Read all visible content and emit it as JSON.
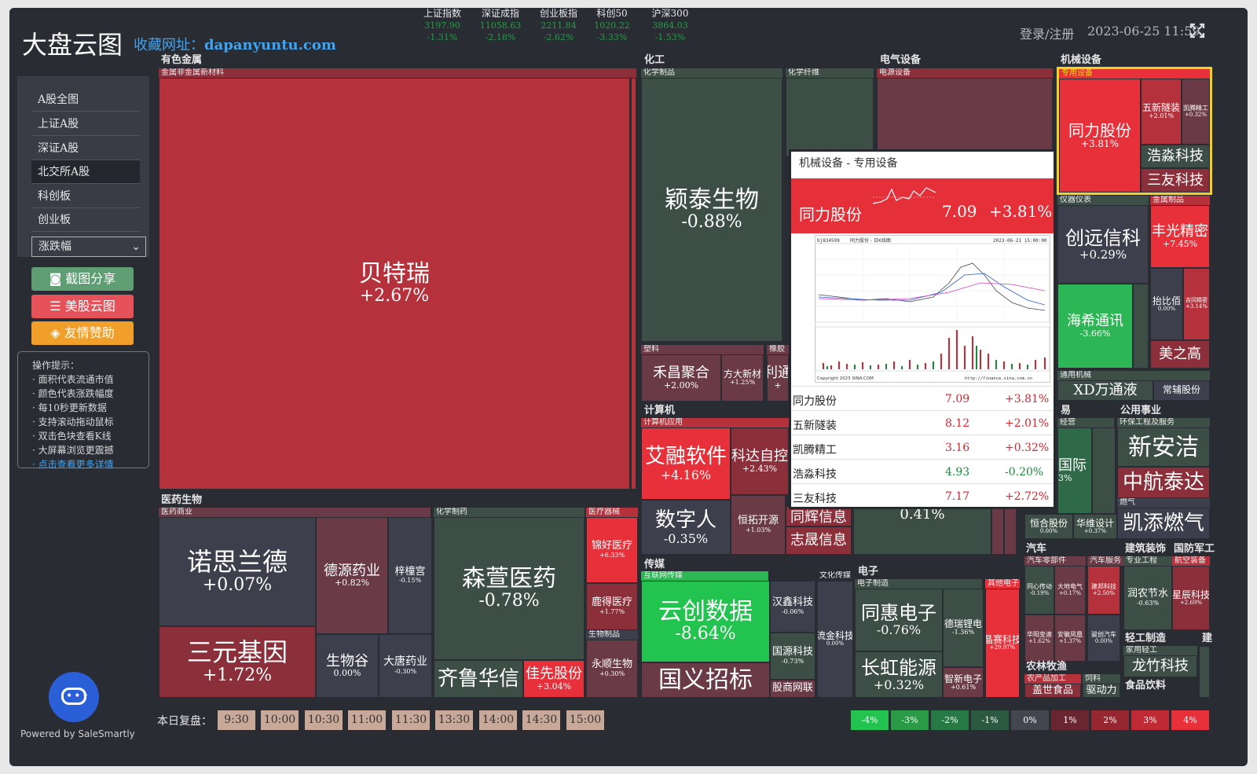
{
  "header": {
    "logo": "大盘云图",
    "fav_label": "收藏网址：",
    "fav_url": "dapanyuntu.com",
    "login": "登录/注册",
    "datetime": "2023-06-25 11:59",
    "indices": [
      {
        "name": "上证指数",
        "value": "3197.90",
        "change": "-1.31%"
      },
      {
        "name": "深证成指",
        "value": "11058.63",
        "change": "-2.18%"
      },
      {
        "name": "创业板指",
        "value": "2211.84",
        "change": "-2.62%"
      },
      {
        "name": "科创50",
        "value": "1020.22",
        "change": "-3.33%"
      },
      {
        "name": "沪深300",
        "value": "3864.03",
        "change": "-1.53%"
      }
    ]
  },
  "sidebar": {
    "items": [
      "A股全图",
      "上证A股",
      "深证A股",
      "北交所A股",
      "科创板",
      "创业板"
    ],
    "select": "涨跌幅",
    "btn_share": "截图分享",
    "btn_us": "美股云图",
    "btn_donate": "友情赞助",
    "tips_title": "操作提示：",
    "tips": [
      "· 面积代表流通市值",
      "· 颜色代表涨跌幅度",
      "· 每10秒更新数据",
      "· 支持滚动拖动鼠标",
      "· 双击色块查看K线",
      "· 大屏幕浏览更震撼"
    ],
    "tips_link": "· 点击查看更多详情",
    "powered": "Powered by SaleSmartly"
  },
  "sectors": {
    "s1": "有色金属",
    "s1a": "金属非金属新材料",
    "s2": "化工",
    "s2a": "化学制品",
    "s2b": "化学纤维",
    "s2c": "塑料",
    "s2d": "橡胶",
    "s3": "电气设备",
    "s3a": "电源设备",
    "s4": "机械设备",
    "s4a": "专用设备",
    "s4b": "仪器仪表",
    "s4c": "金属制品",
    "s4d": "通用机械",
    "s5": "医药生物",
    "s5a": "医药商业",
    "s5b": "化学制药",
    "s5c": "医疗器械",
    "s5d": "生物制品",
    "s6": "计算机",
    "s6a": "计算机应用",
    "s7": "传媒",
    "s7a": "互联网传媒",
    "s7b": "文化传媒",
    "s8": "电子",
    "s8a": "电子制造",
    "s8b": "其他电子",
    "s9": "公用事业",
    "s9a": "环保工程及服务",
    "s9b": "燃气",
    "s10": "汽车",
    "s10a": "汽车零部件",
    "s10b": "汽车服务",
    "s11": "建筑装饰",
    "s11a": "专业工程",
    "s12": "国防军工",
    "s12a": "航空装备",
    "s13": "轻工制造",
    "s13a": "家用轻工",
    "s14": "农林牧渔",
    "s14a": "农产品加工",
    "s14b": "饲料",
    "s15": "食品饮料",
    "s16": "易",
    "s16a": "经营",
    "s17": "建"
  },
  "tiles": {
    "btr": {
      "name": "贝特瑞",
      "pct": "+2.67%"
    },
    "ytsw": {
      "name": "颖泰生物",
      "pct": "-0.88%"
    },
    "hcjh": {
      "name": "禾昌聚合",
      "pct": "+2.00%"
    },
    "fdxc": {
      "name": "方大新材",
      "pct": "+1.25%"
    },
    "lt": {
      "name": "利通",
      "pct": "+"
    },
    "tlgf": {
      "name": "同力股份",
      "pct": "+3.81%"
    },
    "wxsz": {
      "name": "五新隧装",
      "pct": "+2.01%"
    },
    "kpjg": {
      "name": "凯腾精工",
      "pct": "+0.32%"
    },
    "hskj": {
      "name": "浩淼科技"
    },
    "sykj": {
      "name": "三友科技"
    },
    "cyxk": {
      "name": "创远信科",
      "pct": "+0.29%"
    },
    "fgjm": {
      "name": "丰光精密",
      "pct": "+7.45%"
    },
    "hxtx": {
      "name": "海希通讯",
      "pct": "-3.66%"
    },
    "tyb": {
      "name": "抬比佰",
      "pct": "0.00%"
    },
    "gtjm": {
      "name": "吉冈精密",
      "pct": "+3.14%"
    },
    "mzg": {
      "name": "美之高"
    },
    "xdwj": {
      "name": "XD万通液"
    },
    "clgf": {
      "name": "常辅股份"
    },
    "nsld": {
      "name": "诺思兰德",
      "pct": "+0.07%"
    },
    "dyyy": {
      "name": "德源药业",
      "pct": "+0.82%"
    },
    "ztg": {
      "name": "梓橦宫",
      "pct": "-0.15%"
    },
    "syjy": {
      "name": "三元基因",
      "pct": "+1.72%"
    },
    "swg": {
      "name": "生物谷",
      "pct": "0.00%"
    },
    "dtyy": {
      "name": "大唐药业",
      "pct": "-0.30%"
    },
    "sxyy": {
      "name": "森萱医药",
      "pct": "-0.78%"
    },
    "qlhx": {
      "name": "齐鲁华信"
    },
    "jxgf": {
      "name": "佳先股份",
      "pct": "+3.04%"
    },
    "jhyl": {
      "name": "锦好医疗",
      "pct": "+6.33%"
    },
    "ldyl": {
      "name": "鹿得医疗",
      "pct": "+1.77%"
    },
    "sssw": {
      "name": "永顺生物",
      "pct": "+0.30%"
    },
    "arrj": {
      "name": "艾融软件",
      "pct": "+4.16%"
    },
    "kdzk": {
      "name": "科达自控",
      "pct": "+2.43%"
    },
    "szr": {
      "name": "数字人",
      "pct": "-0.35%"
    },
    "htky": {
      "name": "恒拓开源",
      "pct": "+1.03%"
    },
    "tbxx": {
      "name": "同辉信息"
    },
    "zcxx": {
      "name": "志晟信息"
    },
    "cmid": {
      "pct": "0.41%"
    },
    "ycsj": {
      "name": "云创数据",
      "pct": "-8.64%"
    },
    "hxkj": {
      "name": "汉鑫科技",
      "pct": "-0.06%"
    },
    "gykj": {
      "name": "国源科技",
      "pct": "-0.73%"
    },
    "gyzb": {
      "name": "国义招标"
    },
    "gcwy": {
      "name": "股商网联"
    },
    "ljkj": {
      "name": "流金科技",
      "pct": "0.00%"
    },
    "thdz": {
      "name": "同惠电子",
      "pct": "-0.76%"
    },
    "dzld": {
      "name": "德瑞锂电",
      "pct": "-1.36%"
    },
    "chny": {
      "name": "长虹能源",
      "pct": "+0.32%"
    },
    "zndz": {
      "name": "智新电子",
      "pct": "+0.61%"
    },
    "jskj": {
      "name": "晶赛科技",
      "pct": "+29.97%"
    },
    "gj": {
      "name": "国际",
      "pct": "3%"
    },
    "xaj": {
      "name": "新安洁"
    },
    "zhtd": {
      "name": "中航泰达"
    },
    "krrq": {
      "name": "凯添燃气"
    },
    "hhgf": {
      "name": "恒合股份",
      "pct": "0.00%"
    },
    "hxsj": {
      "name": "华维设计",
      "pct": "+0.37%"
    },
    "txkj": {
      "name": "同心传动",
      "pct": "-0.19%"
    },
    "dtdq": {
      "name": "大地电气",
      "pct": "+0.17%"
    },
    "jykj": {
      "name": "建邦科技",
      "pct": "+2.50%"
    },
    "hxbj": {
      "name": "华阳变速",
      "pct": "+1.62%"
    },
    "ahfx": {
      "name": "安徽凤凰",
      "pct": "+1.37%"
    },
    "fzqc": {
      "name": "骏创汽车",
      "pct": "0.00%"
    },
    "rdjs": {
      "name": "润农节水",
      "pct": "-0.63%"
    },
    "xckj": {
      "name": "星辰科技",
      "pct": "+2.69%"
    },
    "lzkj": {
      "name": "龙竹科技"
    },
    "gssp": {
      "name": "盖世食品"
    },
    "qdl": {
      "name": "驱动力"
    }
  },
  "popup": {
    "title": "机械设备 - 专用设备",
    "main_name": "同力股份",
    "main_price": "7.09",
    "main_change": "+3.81%",
    "chart_title": "同力股份 - 日K线图",
    "code": "bj834599",
    "date": "2023-06-21 15:00:00",
    "footer": "Copyright 2023 SINA.COM",
    "footer_r": "http://finance.sina.com.cn",
    "rows": [
      {
        "name": "同力股份",
        "price": "7.09",
        "change": "+3.81%"
      },
      {
        "name": "五新隧装",
        "price": "8.12",
        "change": "+2.01%"
      },
      {
        "name": "凯腾精工",
        "price": "3.16",
        "change": "+0.32%"
      },
      {
        "name": "浩淼科技",
        "price": "4.93",
        "change": "-0.20%"
      },
      {
        "name": "三友科技",
        "price": "7.17",
        "change": "+2.72%"
      }
    ]
  },
  "replay": {
    "label": "本日复盘：",
    "times": [
      "9:30",
      "10:00",
      "10:30",
      "11:00",
      "11:30",
      "13:30",
      "14:00",
      "14:30",
      "15:00"
    ]
  },
  "legend": [
    "-4%",
    "-3%",
    "-2%",
    "-1%",
    "0%",
    "1%",
    "2%",
    "3%",
    "4%"
  ],
  "colors": {
    "up": "#e8303a",
    "down": "#22c44f",
    "bg": "#2a2c34",
    "link": "#3fa4f0"
  }
}
